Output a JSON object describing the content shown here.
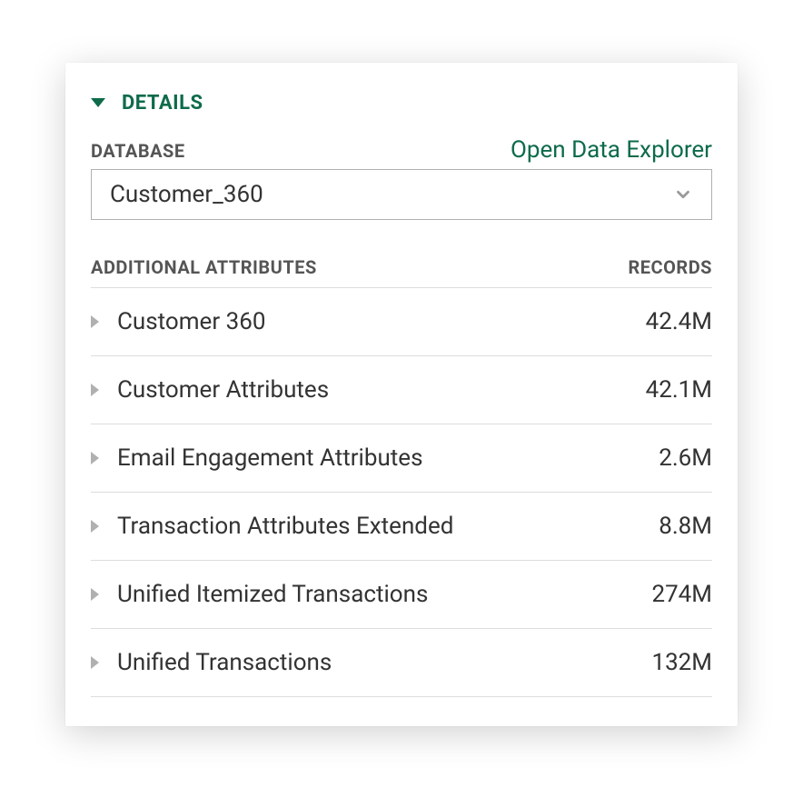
{
  "section": {
    "title": "DETAILS"
  },
  "database": {
    "label": "DATABASE",
    "open_link": "Open Data Explorer",
    "selected": "Customer_360"
  },
  "table": {
    "header_name": "ADDITIONAL ATTRIBUTES",
    "header_records": "RECORDS",
    "rows": [
      {
        "name": "Customer 360",
        "records": "42.4M"
      },
      {
        "name": "Customer Attributes",
        "records": "42.1M"
      },
      {
        "name": "Email Engagement Attributes",
        "records": "2.6M"
      },
      {
        "name": "Transaction Attributes Extended",
        "records": "8.8M"
      },
      {
        "name": "Unified Itemized Transactions",
        "records": "274M"
      },
      {
        "name": "Unified Transactions",
        "records": "132M"
      }
    ]
  }
}
